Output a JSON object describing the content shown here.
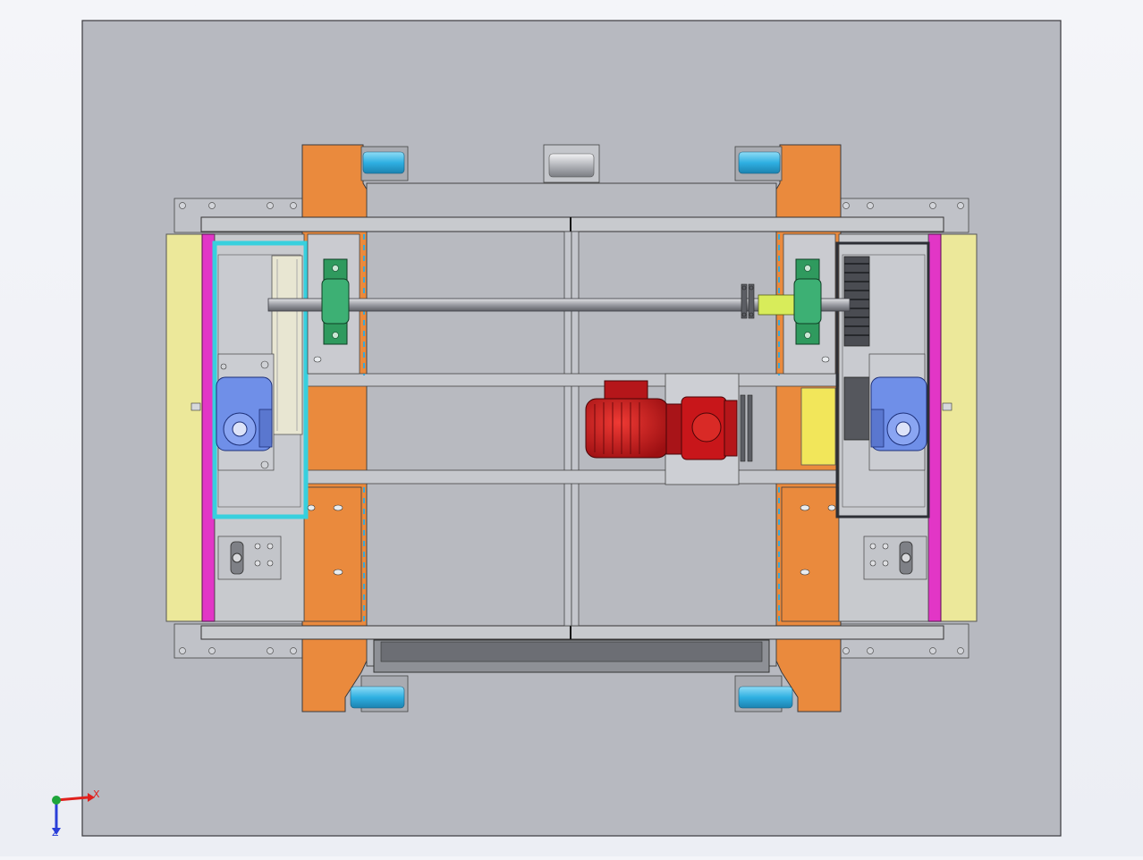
{
  "viewport": {
    "triad": {
      "x_label": "X",
      "z_label": "Z",
      "x_color": "#e0201c",
      "y_color": "#1ea53a",
      "z_color": "#2a3fd8"
    }
  },
  "colors": {
    "background": "#eceef4",
    "base_plate": "#b7b9c0",
    "frame": "#c3c5cb",
    "orange_rail": "#ea8a3d",
    "roller": "#37b7e6",
    "yellow_pad": "#ece89a",
    "magenta_strip": "#e236c6",
    "cyan_frame": "#37d0de",
    "motor": "#c8161a",
    "bearing": "#2f9a5e",
    "gearbox": "#6f8fe8",
    "shaft_coupling": "#d8ec5a"
  },
  "components": [
    "base-plate",
    "orange-rail",
    "roller",
    "side-bumper-pad",
    "magenta-strip",
    "cross-beam",
    "drive-shaft",
    "pillow-block-bearing",
    "drive-motor",
    "worm-gearbox",
    "sprocket",
    "spur-gear",
    "caster-wheel",
    "shaft-coupling"
  ]
}
